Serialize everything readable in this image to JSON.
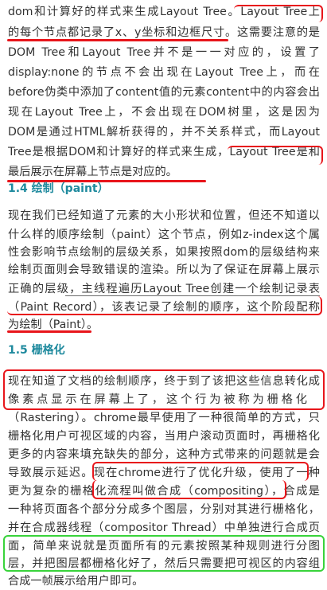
{
  "intro_lines": [
    "dom和计算好的样式来生成Layout Tree。Layout Tree上",
    "的每个节点都记录了x、y坐标和边框尺寸。这需要注意的是",
    "DOM Tree和Layout Tree并不是一一对应的，设置了",
    "display:none的节点不会出现在Layout Tree上，而在",
    "before伪类中添加了content值的元素content中的内容会出",
    "现在Layout Tree上，不会出现在DOM树里，这是因为",
    "DOM是通过HTML解析获得的，并不关系样式，而Layout",
    "Tree是根据DOM和计算好的样式来生成，Layout Tree是和",
    "最后展示在屏幕上节点是对应的。"
  ],
  "section_paint": {
    "heading": "1.4 绘制（paint）",
    "lines": [
      "现在我们已经知道了元素的大小形状和位置，但还不知道以",
      "什么样的顺序绘制（paint）这个节点，例如z-index这个属",
      "性会影响节点绘制的层级关系，如果按照dom的层级结构来",
      "绘制页面则会导致错误的渲染。所以为了保证在屏幕上展示",
      "正确的层级，主线程遍历Layout Tree创建一个绘制记录表",
      "（Paint Record），该表记录了绘制的顺序，这个阶段配称",
      "为绘制（Paint）。"
    ]
  },
  "section_raster": {
    "heading": "1.5 栅格化",
    "lines": [
      "现在知道了文档的绘制顺序，终于到了该把这些信息转化成",
      "像素点显示在屏幕上了，这个行为被称为栅格化",
      "（Rastering）。chrome最早使用了一种很简单的方式，只",
      "栅格化用户可视区域的内容，当用户滚动页面时，再栅格化",
      "更多的内容来填充缺失的部分，这种方式带来的问题就是会",
      "导致展示延迟。现在chrome进行了优化升级，使用了一种",
      "更为复杂的栅格化流程叫做合成（compositing），合成是",
      "一种将页面各个部分分成多个图层，分别对其进行栅格化，",
      "并在合成器线程（compositor Thread）中单独进行合成页",
      "面，简单来说就是页面所有的元素按照某种规则进行分图",
      "层，并把图层都栅格化好了，然后只需要把可视区的内容组",
      "合成一帧展示给用户即可。"
    ]
  },
  "colors": {
    "text": "#333333",
    "heading": "#1f8a9e",
    "annotation_red": "#e8151b",
    "annotation_green": "#39d33b"
  }
}
